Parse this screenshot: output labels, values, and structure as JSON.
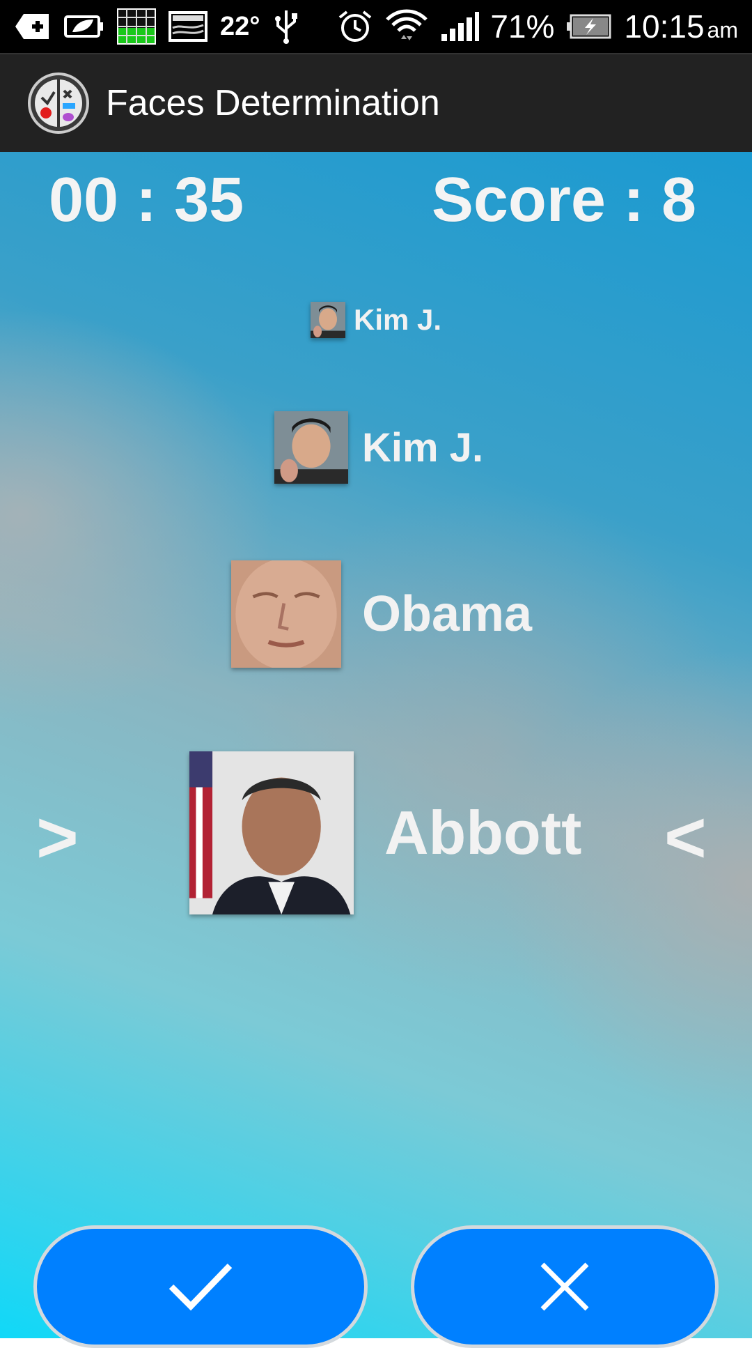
{
  "status_bar": {
    "temperature": "22°",
    "battery_percent": "71%",
    "time": "10:15",
    "ampm": "am",
    "icons": [
      "add-notification-icon",
      "battery-saver-icon",
      "grid-widget-icon",
      "image-icon",
      "usb-icon",
      "alarm-icon",
      "wifi-icon",
      "signal-icon",
      "battery-charging-icon"
    ]
  },
  "action_bar": {
    "title": "Faces Determination",
    "app_icon": "faces-app-icon"
  },
  "game": {
    "timer": "00 : 35",
    "score": "Score : 8",
    "rows": [
      {
        "name": "Kim J.",
        "face_icon": "face-thumbnail-kim"
      },
      {
        "name": "Kim J.",
        "face_icon": "face-thumbnail-kim"
      },
      {
        "name": "Obama",
        "face_icon": "face-thumbnail-abbott"
      },
      {
        "name": "Abbott",
        "face_icon": "face-thumbnail-obama"
      }
    ],
    "arrow_left": ">",
    "arrow_right": "<"
  },
  "buttons": {
    "yes_icon": "checkmark-icon",
    "no_icon": "x-icon"
  },
  "colors": {
    "button": "#0080ff",
    "action_bar": "#222222",
    "status_bar": "#000000"
  }
}
